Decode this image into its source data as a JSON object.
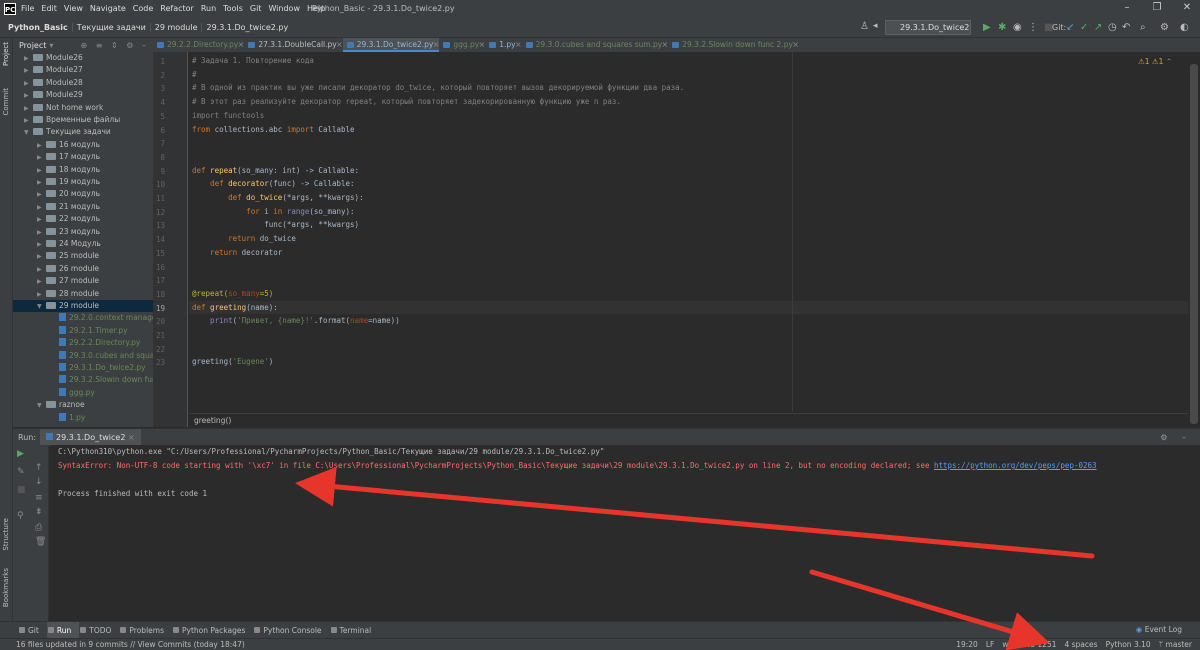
{
  "menu": {
    "items": [
      "File",
      "Edit",
      "View",
      "Navigate",
      "Code",
      "Refactor",
      "Run",
      "Tools",
      "Git",
      "Window",
      "Help"
    ],
    "window_title": "Python_Basic - 29.3.1.Do_twice2.py"
  },
  "navbar": {
    "crumbs": [
      "Python_Basic",
      "Текущие задачи",
      "29 module",
      "29.3.1.Do_twice2.py"
    ],
    "run_config": "29.3.1.Do_twice2",
    "git_label": "Git:"
  },
  "project_header": "Project",
  "tabs": [
    {
      "label": "29.2.2.Directory.py",
      "style": "green"
    },
    {
      "label": "27.3.1.DoubleCall.py",
      "style": "white"
    },
    {
      "label": "29.3.1.Do_twice2.py",
      "style": "active"
    },
    {
      "label": "ggg.py",
      "style": "green"
    },
    {
      "label": "1.py",
      "style": "blue"
    },
    {
      "label": "29.3.0.cubes and squares sum.py",
      "style": "green"
    },
    {
      "label": "29.3.2.Slowin down func 2.py",
      "style": "green"
    }
  ],
  "tree": [
    {
      "label": "Module26",
      "indent": 1,
      "type": "folder",
      "open": false
    },
    {
      "label": "Module27",
      "indent": 1,
      "type": "folder",
      "open": false
    },
    {
      "label": "Module28",
      "indent": 1,
      "type": "folder",
      "open": false
    },
    {
      "label": "Module29",
      "indent": 1,
      "type": "folder",
      "open": false
    },
    {
      "label": "Not home work",
      "indent": 1,
      "type": "folder",
      "open": false
    },
    {
      "label": "Временные файлы",
      "indent": 1,
      "type": "folder",
      "open": false
    },
    {
      "label": "Текущие задачи",
      "indent": 1,
      "type": "folder",
      "open": true
    },
    {
      "label": "16 модуль",
      "indent": 2,
      "type": "folder",
      "open": false
    },
    {
      "label": "17 модуль",
      "indent": 2,
      "type": "folder",
      "open": false
    },
    {
      "label": "18 модуль",
      "indent": 2,
      "type": "folder",
      "open": false
    },
    {
      "label": "19 модуль",
      "indent": 2,
      "type": "folder",
      "open": false
    },
    {
      "label": "20 модуль",
      "indent": 2,
      "type": "folder",
      "open": false
    },
    {
      "label": "21 модуль",
      "indent": 2,
      "type": "folder",
      "open": false
    },
    {
      "label": "22 модуль",
      "indent": 2,
      "type": "folder",
      "open": false
    },
    {
      "label": "23 модуль",
      "indent": 2,
      "type": "folder",
      "open": false
    },
    {
      "label": "24 Модуль",
      "indent": 2,
      "type": "folder",
      "open": false
    },
    {
      "label": "25 module",
      "indent": 2,
      "type": "folder",
      "open": false
    },
    {
      "label": "26 module",
      "indent": 2,
      "type": "folder",
      "open": false
    },
    {
      "label": "27 module",
      "indent": 2,
      "type": "folder",
      "open": false
    },
    {
      "label": "28 module",
      "indent": 2,
      "type": "folder",
      "open": false
    },
    {
      "label": "29 module",
      "indent": 2,
      "type": "folder",
      "open": true,
      "selected": true
    },
    {
      "label": "29.2.0.context manager",
      "indent": 3,
      "type": "file"
    },
    {
      "label": "29.2.1.Timer.py",
      "indent": 3,
      "type": "file"
    },
    {
      "label": "29.2.2.Directory.py",
      "indent": 3,
      "type": "file"
    },
    {
      "label": "29.3.0.cubes and squares",
      "indent": 3,
      "type": "file"
    },
    {
      "label": "29.3.1.Do_twice2.py",
      "indent": 3,
      "type": "file"
    },
    {
      "label": "29.3.2.Slowin down fun",
      "indent": 3,
      "type": "file"
    },
    {
      "label": "ggg.py",
      "indent": 3,
      "type": "file"
    },
    {
      "label": "raznoe",
      "indent": 2,
      "type": "folder",
      "open": true
    },
    {
      "label": "1.py",
      "indent": 3,
      "type": "file"
    }
  ],
  "code": {
    "l1": "# Задача 1. Повторение кода",
    "l2": "#",
    "l3": "# В одной из практик вы уже писали декоратор do_twice, который повторяет вызов декорируемой функции два раза.",
    "l4": "# В этот раз реализуйте декоратор repeat, который повторяет задекорированную функцию уже n раз.",
    "l5_kw": "import",
    "l5_rest": " functools",
    "l6_kw1": "from",
    "l6_mid": " collections.abc ",
    "l6_kw2": "import",
    "l6_rest": " Callable",
    "l9_kw": "def",
    "l9_fn": " repeat",
    "l9_rest": "(so_many: int) -> Callable:",
    "l10_kw": "    def",
    "l10_fn": " decorator",
    "l10_rest": "(func) -> Callable:",
    "l11_kw": "        def",
    "l11_fn": " do_twice",
    "l11_rest": "(*args, **kwargs):",
    "l12_kw": "            for",
    "l12_mid": " i ",
    "l12_kw2": "in",
    "l12_bi": " range",
    "l12_rest": "(so_many):",
    "l13": "                func(*args, **kwargs)",
    "l14_kw": "        return",
    "l14_rest": " do_twice",
    "l15_kw": "    return",
    "l15_rest": " decorator",
    "l18_dec": "@repeat(",
    "l18_prm": "so_many",
    "l18_rest": "=5)",
    "l19_kw": "def",
    "l19_fn": " greeting",
    "l19_rest": "(name):",
    "l20_bi": "    print",
    "l20_a": "(",
    "l20_st": "'Привет, {name}!'",
    "l20_b": ".format(",
    "l20_prm": "name",
    "l20_c": "=name))",
    "l23_a": "greeting(",
    "l23_st": "'Eugene'",
    "l23_b": ")"
  },
  "line_numbers": [
    "1",
    "2",
    "3",
    "4",
    "5",
    "6",
    "7",
    "8",
    "9",
    "10",
    "11",
    "12",
    "13",
    "14",
    "15",
    "16",
    "17",
    "18",
    "19",
    "20",
    "21",
    "22",
    "23"
  ],
  "warnings": "1",
  "errors_count": "1",
  "editor_crumb": "greeting()",
  "run": {
    "label": "Run:",
    "tab": "29.3.1.Do_twice2",
    "line1": "C:\\Python310\\python.exe \"C:/Users/Professional/PycharmProjects/Python_Basic/Текущие задачи/29 module/29.3.1.Do_twice2.py\"",
    "line2": "SyntaxError: Non-UTF-8 code starting with '\\xc7' in file C:\\Users\\Professional\\PycharmProjects\\Python_Basic\\Текущие задачи\\29 module\\29.3.1.Do_twice2.py on line 2, but no encoding declared; see ",
    "line2_link": "https://python.org/dev/peps/pep-0263",
    "line3": "Process finished with exit code 1"
  },
  "bottom_tabs": [
    "Git",
    "Run",
    "TODO",
    "Problems",
    "Python Packages",
    "Python Console",
    "Terminal"
  ],
  "event_log": "Event Log",
  "status": {
    "left": "16 files updated in 9 commits // View Commits (today 18:47)",
    "position": "19:20",
    "line_sep": "LF",
    "encoding": "windows-1251",
    "indent": "4 spaces",
    "interpreter": "Python 3.10",
    "branch": "master"
  },
  "side_tabs": {
    "project": "Project",
    "commit": "Commit",
    "structure": "Structure",
    "bookmarks": "Bookmarks"
  },
  "accent_colors": {
    "arrow": "#e8352b",
    "keyword": "#cc7832",
    "error": "#ff6b68"
  }
}
